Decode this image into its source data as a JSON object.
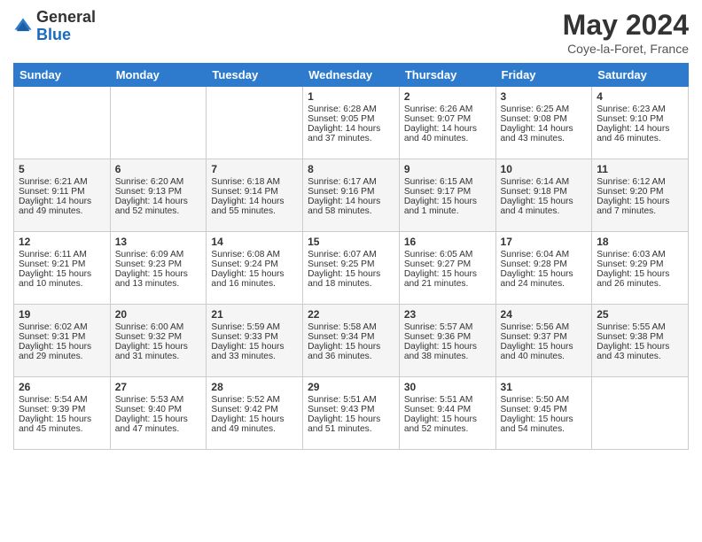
{
  "logo": {
    "general": "General",
    "blue": "Blue"
  },
  "header": {
    "month": "May 2024",
    "location": "Coye-la-Foret, France"
  },
  "weekdays": [
    "Sunday",
    "Monday",
    "Tuesday",
    "Wednesday",
    "Thursday",
    "Friday",
    "Saturday"
  ],
  "weeks": [
    [
      {
        "day": "",
        "data": ""
      },
      {
        "day": "",
        "data": ""
      },
      {
        "day": "",
        "data": ""
      },
      {
        "day": "1",
        "data": "Sunrise: 6:28 AM\nSunset: 9:05 PM\nDaylight: 14 hours and 37 minutes."
      },
      {
        "day": "2",
        "data": "Sunrise: 6:26 AM\nSunset: 9:07 PM\nDaylight: 14 hours and 40 minutes."
      },
      {
        "day": "3",
        "data": "Sunrise: 6:25 AM\nSunset: 9:08 PM\nDaylight: 14 hours and 43 minutes."
      },
      {
        "day": "4",
        "data": "Sunrise: 6:23 AM\nSunset: 9:10 PM\nDaylight: 14 hours and 46 minutes."
      }
    ],
    [
      {
        "day": "5",
        "data": "Sunrise: 6:21 AM\nSunset: 9:11 PM\nDaylight: 14 hours and 49 minutes."
      },
      {
        "day": "6",
        "data": "Sunrise: 6:20 AM\nSunset: 9:13 PM\nDaylight: 14 hours and 52 minutes."
      },
      {
        "day": "7",
        "data": "Sunrise: 6:18 AM\nSunset: 9:14 PM\nDaylight: 14 hours and 55 minutes."
      },
      {
        "day": "8",
        "data": "Sunrise: 6:17 AM\nSunset: 9:16 PM\nDaylight: 14 hours and 58 minutes."
      },
      {
        "day": "9",
        "data": "Sunrise: 6:15 AM\nSunset: 9:17 PM\nDaylight: 15 hours and 1 minute."
      },
      {
        "day": "10",
        "data": "Sunrise: 6:14 AM\nSunset: 9:18 PM\nDaylight: 15 hours and 4 minutes."
      },
      {
        "day": "11",
        "data": "Sunrise: 6:12 AM\nSunset: 9:20 PM\nDaylight: 15 hours and 7 minutes."
      }
    ],
    [
      {
        "day": "12",
        "data": "Sunrise: 6:11 AM\nSunset: 9:21 PM\nDaylight: 15 hours and 10 minutes."
      },
      {
        "day": "13",
        "data": "Sunrise: 6:09 AM\nSunset: 9:23 PM\nDaylight: 15 hours and 13 minutes."
      },
      {
        "day": "14",
        "data": "Sunrise: 6:08 AM\nSunset: 9:24 PM\nDaylight: 15 hours and 16 minutes."
      },
      {
        "day": "15",
        "data": "Sunrise: 6:07 AM\nSunset: 9:25 PM\nDaylight: 15 hours and 18 minutes."
      },
      {
        "day": "16",
        "data": "Sunrise: 6:05 AM\nSunset: 9:27 PM\nDaylight: 15 hours and 21 minutes."
      },
      {
        "day": "17",
        "data": "Sunrise: 6:04 AM\nSunset: 9:28 PM\nDaylight: 15 hours and 24 minutes."
      },
      {
        "day": "18",
        "data": "Sunrise: 6:03 AM\nSunset: 9:29 PM\nDaylight: 15 hours and 26 minutes."
      }
    ],
    [
      {
        "day": "19",
        "data": "Sunrise: 6:02 AM\nSunset: 9:31 PM\nDaylight: 15 hours and 29 minutes."
      },
      {
        "day": "20",
        "data": "Sunrise: 6:00 AM\nSunset: 9:32 PM\nDaylight: 15 hours and 31 minutes."
      },
      {
        "day": "21",
        "data": "Sunrise: 5:59 AM\nSunset: 9:33 PM\nDaylight: 15 hours and 33 minutes."
      },
      {
        "day": "22",
        "data": "Sunrise: 5:58 AM\nSunset: 9:34 PM\nDaylight: 15 hours and 36 minutes."
      },
      {
        "day": "23",
        "data": "Sunrise: 5:57 AM\nSunset: 9:36 PM\nDaylight: 15 hours and 38 minutes."
      },
      {
        "day": "24",
        "data": "Sunrise: 5:56 AM\nSunset: 9:37 PM\nDaylight: 15 hours and 40 minutes."
      },
      {
        "day": "25",
        "data": "Sunrise: 5:55 AM\nSunset: 9:38 PM\nDaylight: 15 hours and 43 minutes."
      }
    ],
    [
      {
        "day": "26",
        "data": "Sunrise: 5:54 AM\nSunset: 9:39 PM\nDaylight: 15 hours and 45 minutes."
      },
      {
        "day": "27",
        "data": "Sunrise: 5:53 AM\nSunset: 9:40 PM\nDaylight: 15 hours and 47 minutes."
      },
      {
        "day": "28",
        "data": "Sunrise: 5:52 AM\nSunset: 9:42 PM\nDaylight: 15 hours and 49 minutes."
      },
      {
        "day": "29",
        "data": "Sunrise: 5:51 AM\nSunset: 9:43 PM\nDaylight: 15 hours and 51 minutes."
      },
      {
        "day": "30",
        "data": "Sunrise: 5:51 AM\nSunset: 9:44 PM\nDaylight: 15 hours and 52 minutes."
      },
      {
        "day": "31",
        "data": "Sunrise: 5:50 AM\nSunset: 9:45 PM\nDaylight: 15 hours and 54 minutes."
      },
      {
        "day": "",
        "data": ""
      }
    ]
  ]
}
